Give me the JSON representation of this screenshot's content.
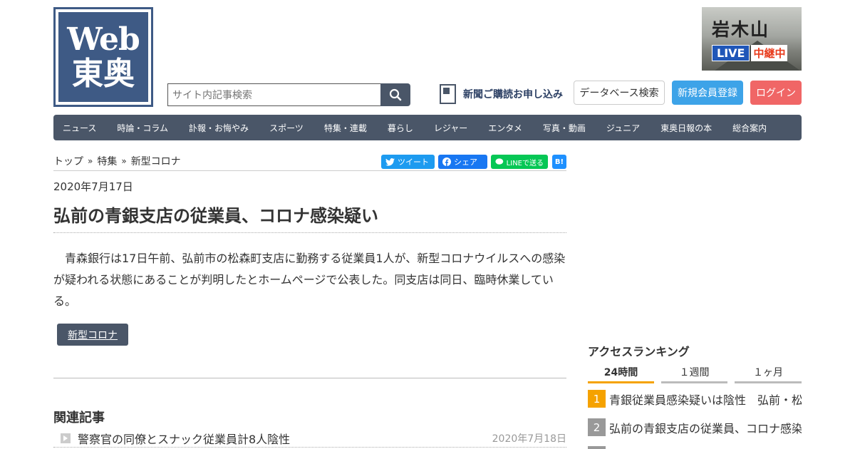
{
  "header": {
    "logo_web": "Web",
    "logo_name": "東奥",
    "search_placeholder": "サイト内記事検索",
    "subscribe_label": "新聞ご購読お申し込み",
    "db_search_label": "データベース検索",
    "register_label": "新規会員登録",
    "login_label": "ログイン",
    "live_banner": {
      "title": "岩木山",
      "live": "LIVE",
      "status": "中継中"
    }
  },
  "nav": {
    "items": [
      "ニュース",
      "時論・コラム",
      "訃報・お悔やみ",
      "スポーツ",
      "特集・連載",
      "暮らし",
      "レジャー",
      "エンタメ",
      "写真・動画",
      "ジュニア",
      "東奥日報の本",
      "総合案内"
    ]
  },
  "breadcrumb": [
    "トップ",
    "特集",
    "新型コロナ"
  ],
  "share": {
    "tweet": "ツイート",
    "facebook": "シェア",
    "line": "LINEで送る",
    "hatena": "B!"
  },
  "article": {
    "date": "2020年7月17日",
    "title": "弘前の青銀支店の従業員、コロナ感染疑い",
    "body": "青森銀行は17日午前、弘前市の松森町支店に勤務する従業員1人が、新型コロナウイルスへの感染が疑われる状態にあることが判明したとホームページで公表した。同支店は同日、臨時休業している。",
    "tag": "新型コロナ"
  },
  "related": {
    "title": "関連記事",
    "items": [
      {
        "text": "警察官の同僚とスナック従業員計8人陰性",
        "date": "2020年7月18日"
      }
    ]
  },
  "ranking": {
    "title": "アクセスランキング",
    "tabs": [
      "24時間",
      "１週間",
      "１ヶ月"
    ],
    "active_tab": 0,
    "items": [
      {
        "rank": "1",
        "text": "青銀従業員感染疑いは陰性　弘前・松森町支店"
      },
      {
        "rank": "2",
        "text": "弘前の青銀支店の従業員、コロナ感染疑い"
      }
    ]
  },
  "colors": {
    "brand": "#3e5a85",
    "nav": "#4a5668",
    "register": "#3da3e8",
    "login": "#f06666",
    "rank_first": "#f5a200"
  }
}
